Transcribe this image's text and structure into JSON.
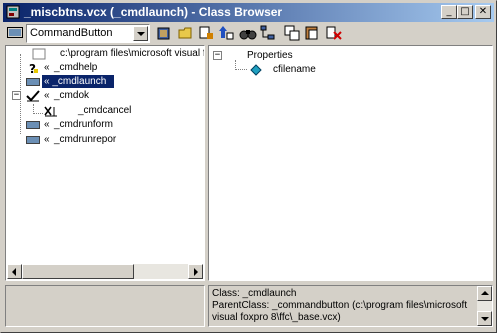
{
  "window": {
    "title": "_miscbtns.vcx (_cmdlaunch) - Class Browser",
    "title_color_start": "#0a246a",
    "title_color_end": "#a6caf0",
    "buttons": {
      "minimize": "_",
      "maximize": "□",
      "close": "✕"
    }
  },
  "toolbar": {
    "class_filter_value": "CommandButton",
    "tools": [
      "open-icon",
      "folder-icon",
      "add-icon",
      "rename-icon",
      "find-icon",
      "tree-view-icon",
      "copy-icon",
      "paste-icon",
      "remove-icon"
    ]
  },
  "class_tree": {
    "root_path": "c:\\program files\\microsoft visual fo",
    "items": [
      {
        "prefix": "«",
        "label": "_cmdhelp",
        "icon": "question-icon"
      },
      {
        "prefix": "«",
        "label": "_cmdlaunch",
        "icon": "button-icon",
        "selected": true
      },
      {
        "prefix": "«",
        "label": "_cmdok",
        "icon": "checkmark-icon",
        "expanded": true
      },
      {
        "prefix": "",
        "label": "_cmdcancel",
        "icon": "cancel-icon",
        "child": true
      },
      {
        "prefix": "«",
        "label": "_cmdrunform",
        "icon": "button-icon"
      },
      {
        "prefix": "«",
        "label": "_cmdrunrepor",
        "icon": "button-icon"
      }
    ]
  },
  "members_tree": {
    "group_label": "Properties",
    "items": [
      {
        "label": "cfilename",
        "icon": "property-icon"
      }
    ]
  },
  "description": {
    "line1": "Class:  _cmdlaunch",
    "line2": "ParentClass:  _commandbutton  (c:\\program files\\microsoft",
    "line3": "visual foxpro 8\\ffc\\_base.vcx)"
  },
  "bottom_left_note": ""
}
